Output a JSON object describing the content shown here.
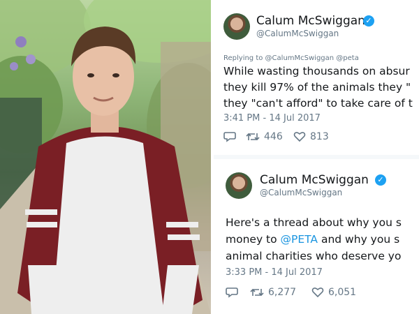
{
  "tweets": [
    {
      "name": "Calum McSwiggan",
      "handle": "@CalumMcSwiggan",
      "replying_to": "Replying to @CalumMcSwiggan @peta",
      "lines": [
        "While wasting thousands on absur",
        "they kill 97% of the animals they \"",
        "they \"can't afford\" to take care of t"
      ],
      "timestamp": "3:41 PM - 14 Jul 2017",
      "retweets": "446",
      "likes": "813"
    },
    {
      "name": "Calum McSwiggan",
      "handle": "@CalumMcSwiggan",
      "line1": "Here's a thread about why you s",
      "line2_before": "money to ",
      "line2_link": "@PETA",
      "line2_after": " and why you s",
      "line3": "animal charities who deserve yo",
      "timestamp": "3:33 PM - 14 Jul 2017",
      "retweets": "6,277",
      "likes": "6,051"
    }
  ],
  "colors": {
    "link": "#1b95e0",
    "verified": "#1da1f2",
    "text": "#14171a",
    "muted": "#657786"
  },
  "icons": [
    "verified-icon",
    "reply-icon",
    "retweet-icon",
    "like-icon"
  ]
}
